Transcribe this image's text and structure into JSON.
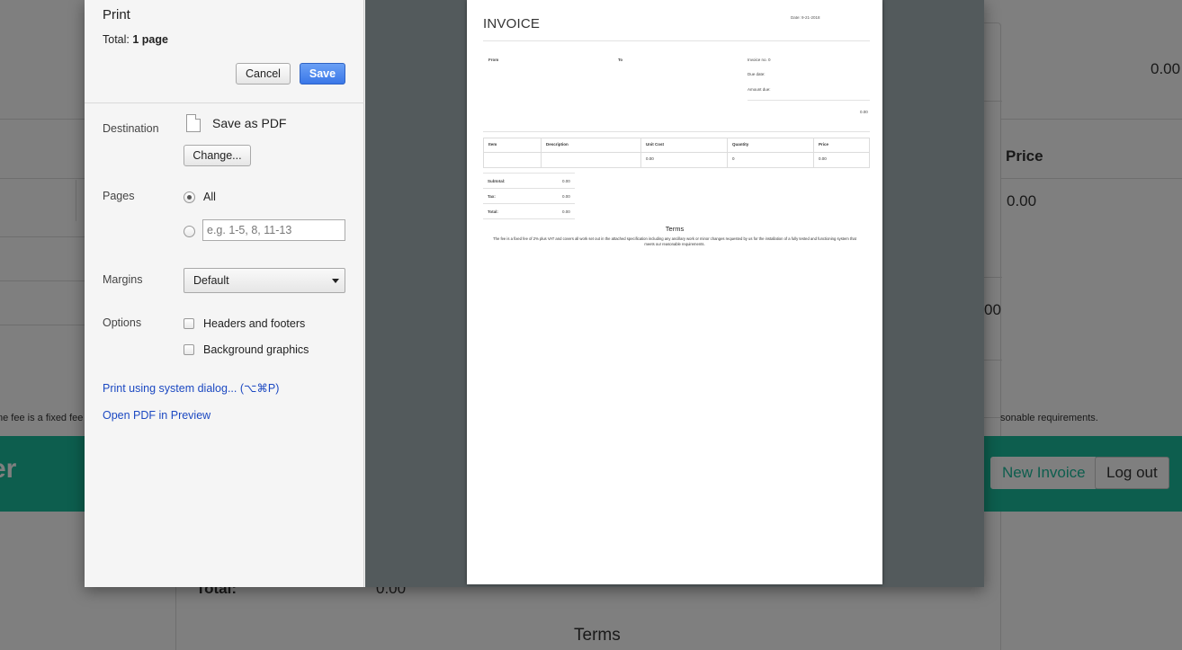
{
  "background": {
    "price_header": "Price",
    "price_value_1": "0.00",
    "price_value_2": "0.00",
    "price_value_3": "00",
    "fee_left": "ne fee is a fixed fee",
    "fee_right": "sonable requirements.",
    "brand": "er",
    "new_invoice": "New Invoice",
    "logout": "Log out",
    "total_label": "Total:",
    "total_value": "0.00",
    "terms": "Terms"
  },
  "dialog": {
    "title": "Print",
    "total_prefix": "Total: ",
    "total_pages": "1 page",
    "cancel": "Cancel",
    "save": "Save",
    "destination_label": "Destination",
    "destination_value": "Save as PDF",
    "change": "Change...",
    "pages_label": "Pages",
    "pages_all": "All",
    "pages_placeholder": "e.g. 1-5, 8, 11-13",
    "margins_label": "Margins",
    "margins_value": "Default",
    "options_label": "Options",
    "option_headers": "Headers and footers",
    "option_background": "Background graphics",
    "link_system": "Print using system dialog... (⌥⌘P)",
    "link_preview": "Open PDF in Preview"
  },
  "preview": {
    "title": "INVOICE",
    "date": "Date: 9-21-2018",
    "from": "From",
    "to": "To",
    "invoice_no": "Invoice no. 0",
    "due_date": "Due date:",
    "amount_due": "Amount due:",
    "amount_value": "0.00",
    "columns": [
      "Item",
      "Description",
      "Unit Cost",
      "Quantity",
      "Price"
    ],
    "row": [
      "",
      "",
      "0.00",
      "0",
      "0.00"
    ],
    "subtotal_label": "Subtotal:",
    "subtotal_value": "0.00",
    "tax_label": "Tax:",
    "tax_value": "0.00",
    "total_label": "Total:",
    "total_value": "0.00",
    "terms_heading": "Terms",
    "terms_text": "The fee is a fixed fee of 2% plus VAT and covers all work set out in the attached specification including any ancillary work or minor changes requested by us for the installation of a fully tested and functioning system that meets our reasonable requirements."
  }
}
